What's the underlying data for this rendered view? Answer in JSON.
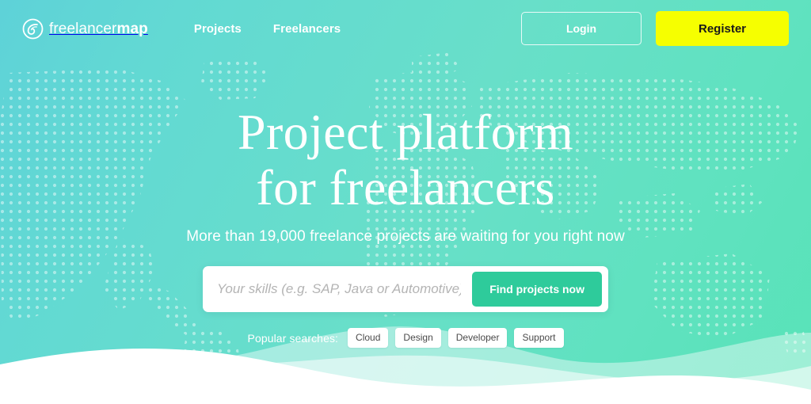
{
  "brand": {
    "logo_icon": "swirl-circle-icon",
    "name_light": "freelancer",
    "name_bold": "map"
  },
  "header": {
    "nav": [
      {
        "label": "Projects"
      },
      {
        "label": "Freelancers"
      }
    ],
    "login_label": "Login",
    "register_label": "Register"
  },
  "hero": {
    "headline_line1": "Project platform",
    "headline_line2": "for freelancers",
    "subline": "More than 19,000 freelance projects are waiting for you right now"
  },
  "search": {
    "placeholder": "Your skills (e.g. SAP, Java or Automotive)",
    "value": "",
    "button_label": "Find projects now"
  },
  "popular": {
    "label": "Popular searches:",
    "tags": [
      {
        "label": "Cloud"
      },
      {
        "label": "Design"
      },
      {
        "label": "Developer"
      },
      {
        "label": "Support"
      }
    ]
  },
  "colors": {
    "background_start": "#5ed2d8",
    "background_end": "#58e3b8",
    "register_yellow": "#f6ff00",
    "find_button_green": "#2ecb9b",
    "text_white": "#ffffff",
    "tag_text": "#4a4a4a",
    "wave_white": "#ffffff",
    "wave_light": "#b9ece1"
  }
}
